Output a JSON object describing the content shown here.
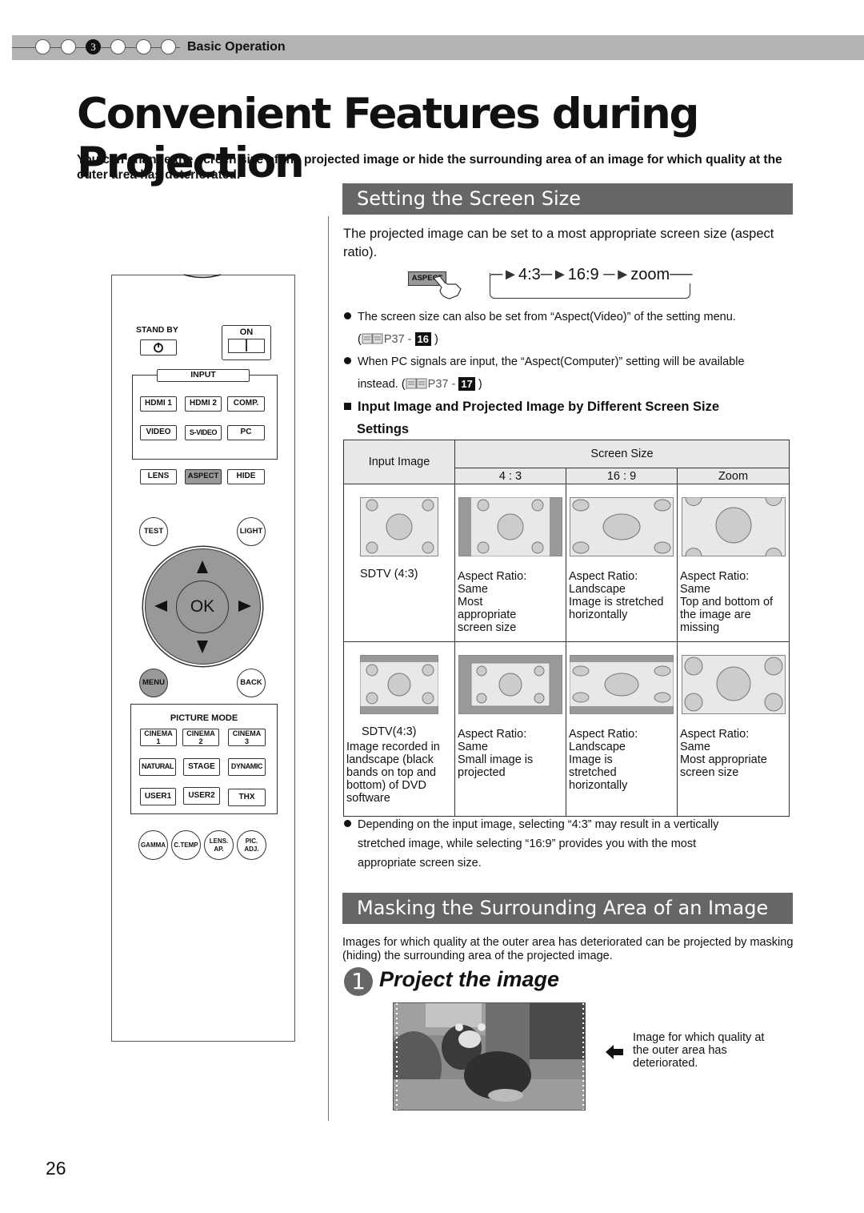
{
  "header": {
    "chapter_dots": [
      "",
      "",
      "3",
      "",
      "",
      ""
    ],
    "active_chapter": 3,
    "section_label": "Basic Operation",
    "bar_color": "#b3b3b3"
  },
  "title": "Convenient Features during Projection",
  "intro": "You can change the screen size of the projected image or hide the surrounding area of an image for which quality at the outer area has deteriorated.",
  "screen_size": {
    "heading": "Setting the Screen Size",
    "description": "The projected image can be set to a most appropriate screen size (aspect ratio).",
    "aspect_button": "ASPECT",
    "cycle": [
      "4:3",
      "16:9",
      "zoom"
    ],
    "notes": [
      {
        "text": "The screen size can also be set from “Aspect(Video)” of the setting menu.",
        "ref_page": "P37 -",
        "ref_num": "16"
      },
      {
        "text": "When PC signals are input, the “Aspect(Computer)” setting will be available",
        "cont": "instead. (",
        "ref_page": "P37 -",
        "ref_num": "17"
      }
    ],
    "subheading_line1": "Input Image and Projected Image by Different Screen Size",
    "subheading_line2": "Settings",
    "table": {
      "col_input": "Input Image",
      "col_group": "Screen Size",
      "cols": [
        "4 : 3",
        "16 : 9",
        "Zoom"
      ],
      "rows": [
        {
          "input_label": "SDTV (4:3)",
          "cells": [
            "Aspect Ratio:\nSame\nMost\nappropriate\nscreen size",
            "Aspect Ratio:\nLandscape\nImage is stretched\nhorizontally",
            "Aspect Ratio:\nSame\nTop and bottom of\nthe image are\nmissing"
          ]
        },
        {
          "input_label": "SDTV(4:3)",
          "input_desc": "Image recorded in\nlandscape (black\nbands on top and\nbottom) of DVD\nsoftware",
          "cells": [
            "Aspect Ratio:\nSame\nSmall image is\nprojected",
            "Aspect Ratio:\nLandscape\nImage is\nstretched\nhorizontally",
            "Aspect Ratio:\nSame\nMost appropriate\nscreen size"
          ]
        }
      ]
    },
    "footnote_lines": [
      "Depending on the input image, selecting “4:3” may result in a vertically",
      "stretched image, while selecting “16:9” provides you with the most",
      "appropriate screen size."
    ]
  },
  "masking": {
    "heading": "Masking the Surrounding Area of an Image",
    "description": "Images for which quality at the outer area has deteriorated can be projected by masking (hiding) the surrounding area of the projected image.",
    "step_number": "1",
    "step_title": "Project the image",
    "photo_note": "Image for which quality at the outer area has deteriorated."
  },
  "remote": {
    "standby": "STAND BY",
    "on": "ON",
    "input_label": "INPUT",
    "input_buttons": [
      "HDMI 1",
      "HDMI 2",
      "COMP.",
      "VIDEO",
      "S-VIDEO",
      "PC"
    ],
    "row_buttons": [
      "LENS",
      "ASPECT",
      "HIDE"
    ],
    "test": "TEST",
    "light": "LIGHT",
    "ok": "OK",
    "menu": "MENU",
    "back": "BACK",
    "picture_mode_label": "PICTURE MODE",
    "picture_modes": [
      "CINEMA 1",
      "CINEMA 2",
      "CINEMA 3",
      "NATURAL",
      "STAGE",
      "DYNAMIC",
      "USER1",
      "USER2",
      "THX"
    ],
    "bottom_buttons": [
      "GAMMA",
      "C.TEMP",
      "LENS. AP.",
      "PIC. ADJ."
    ]
  },
  "page_number": "26",
  "colors": {
    "section_bar": "#666666",
    "button_highlight": "#999999"
  }
}
